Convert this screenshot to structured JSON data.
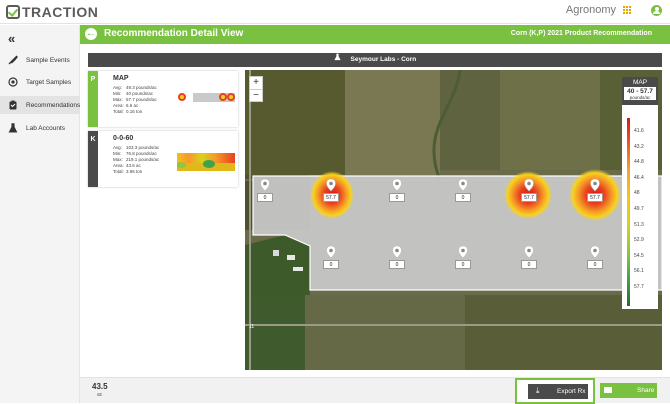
{
  "app": {
    "brand": "TRACTION",
    "workspace": "Agronomy"
  },
  "sidebar": {
    "collapse_glyph": "«",
    "items": [
      {
        "label": "Sample Events",
        "icon": "shovel-icon"
      },
      {
        "label": "Target Samples",
        "icon": "target-icon"
      },
      {
        "label": "Recommendations",
        "icon": "clipboard-icon",
        "active": true
      },
      {
        "label": "Lab Accounts",
        "icon": "flask-icon"
      }
    ]
  },
  "header": {
    "title": "Recommendation Detail View",
    "subtitle": "Corn (K,P) 2021 Product Recommendation"
  },
  "lab": {
    "label": "Seymour Labs - Corn"
  },
  "zoom": {
    "in": "+",
    "out": "−"
  },
  "panels": [
    {
      "letter": "P",
      "name": "MAP",
      "color": "#7ac142",
      "stats": [
        {
          "k": "Avg:",
          "v": "49.3 pounds/ac"
        },
        {
          "k": "Min:",
          "v": "40 pounds/ac"
        },
        {
          "k": "Max:",
          "v": "57.7 pounds/ac"
        },
        {
          "k": "Area:",
          "v": "6.6 ac"
        },
        {
          "k": "Total:",
          "v": "0.16 ton"
        }
      ]
    },
    {
      "letter": "K",
      "name": "0-0-60",
      "color": "#4a4a4a",
      "stats": [
        {
          "k": "Avg:",
          "v": "103.3 pounds/ac"
        },
        {
          "k": "Min:",
          "v": "76.8 pounds/ac"
        },
        {
          "k": "Max:",
          "v": "219.1 pounds/ac"
        },
        {
          "k": "Area:",
          "v": "43.6 ac"
        },
        {
          "k": "Total:",
          "v": "3.96 ton"
        }
      ]
    }
  ],
  "map_markers": [
    "0",
    "57.7",
    "0",
    "0",
    "57.7",
    "57.7",
    "0",
    "0",
    "0",
    "0",
    "0"
  ],
  "legend": {
    "title": "MAP",
    "range": "40 - 57.7",
    "unit": "pounds/ac",
    "ticks": [
      "41.6",
      "43.2",
      "44.8",
      "46.4",
      "48",
      "49.7",
      "51.3",
      "52.9",
      "54.5",
      "56.1",
      "57.7"
    ]
  },
  "road_label": "11",
  "footer": {
    "acres_value": "43.5",
    "acres_unit": "ac",
    "export_label": "Export Rx",
    "share_label": "Share"
  }
}
